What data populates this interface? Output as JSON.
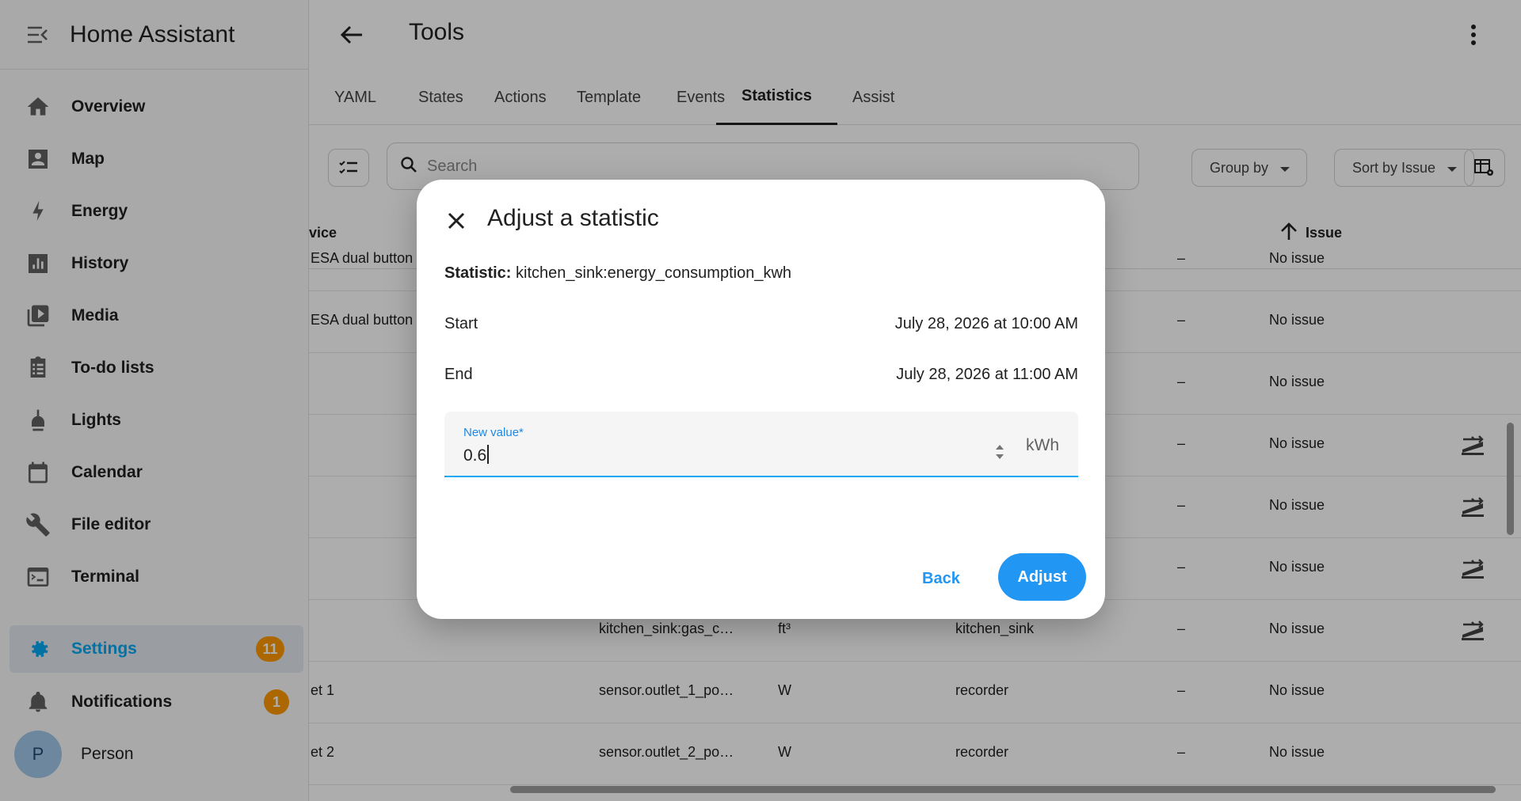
{
  "app": {
    "title": "Home Assistant"
  },
  "sidebar": {
    "items": [
      {
        "label": "Overview",
        "icon": "home-icon"
      },
      {
        "label": "Map",
        "icon": "map-account-icon"
      },
      {
        "label": "Energy",
        "icon": "lightning-icon"
      },
      {
        "label": "History",
        "icon": "chart-box-icon"
      },
      {
        "label": "Media",
        "icon": "media-play-icon"
      },
      {
        "label": "To-do lists",
        "icon": "clipboard-list-icon"
      },
      {
        "label": "Lights",
        "icon": "lamp-icon"
      },
      {
        "label": "Calendar",
        "icon": "calendar-icon"
      },
      {
        "label": "File editor",
        "icon": "wrench-icon"
      },
      {
        "label": "Terminal",
        "icon": "console-icon"
      }
    ],
    "settings": {
      "label": "Settings",
      "badge": "11"
    },
    "notifications": {
      "label": "Notifications",
      "badge": "1"
    },
    "user": {
      "initial": "P",
      "name": "Person"
    }
  },
  "page": {
    "title": "Tools"
  },
  "tabs": [
    "YAML",
    "States",
    "Actions",
    "Template",
    "Events",
    "Statistics",
    "Assist"
  ],
  "active_tab": "Statistics",
  "toolbar": {
    "search_placeholder": "Search",
    "group_by": "Group by",
    "sort_by": "Sort by Issue"
  },
  "table": {
    "headers": {
      "device_partial": "vice",
      "issue": "Issue"
    },
    "rows": [
      {
        "name": "ESA dual button",
        "statistic": "",
        "unit": "",
        "source": "",
        "dash": "–",
        "issue": "No issue",
        "has_action": false
      },
      {
        "name": "ESA dual button",
        "statistic": "",
        "unit": "",
        "source": "",
        "dash": "–",
        "issue": "No issue",
        "has_action": false
      },
      {
        "name": "",
        "statistic": "",
        "unit": "",
        "source": "",
        "dash": "–",
        "issue": "No issue",
        "has_action": false
      },
      {
        "name": "",
        "statistic": "",
        "unit": "",
        "source": "",
        "dash": "–",
        "issue": "No issue",
        "has_action": true
      },
      {
        "name": "",
        "statistic": "",
        "unit": "",
        "source": "",
        "dash": "–",
        "issue": "No issue",
        "has_action": true
      },
      {
        "name": "",
        "statistic": "",
        "unit": "",
        "source": "",
        "dash": "–",
        "issue": "No issue",
        "has_action": true
      },
      {
        "name": "",
        "statistic": "kitchen_sink:gas_c…",
        "unit": "ft³",
        "source": "kitchen_sink",
        "dash": "–",
        "issue": "No issue",
        "has_action": true
      },
      {
        "name": "et 1",
        "statistic": "sensor.outlet_1_po…",
        "unit": "W",
        "source": "recorder",
        "dash": "–",
        "issue": "No issue",
        "has_action": false
      },
      {
        "name": "et 2",
        "statistic": "sensor.outlet_2_po…",
        "unit": "W",
        "source": "recorder",
        "dash": "–",
        "issue": "No issue",
        "has_action": false
      }
    ]
  },
  "dialog": {
    "title": "Adjust a statistic",
    "statistic_label": "Statistic:",
    "statistic_value": "kitchen_sink:energy_consumption_kwh",
    "start_label": "Start",
    "start_value": "July 28, 2026 at 10:00 AM",
    "end_label": "End",
    "end_value": "July 28, 2026 at 11:00 AM",
    "field_label": "New value*",
    "field_value": "0.6",
    "field_unit": "kWh",
    "back_label": "Back",
    "adjust_label": "Adjust"
  },
  "colors": {
    "accent": "#03a9f4",
    "button": "#2196f3",
    "badge": "#ff9800"
  }
}
